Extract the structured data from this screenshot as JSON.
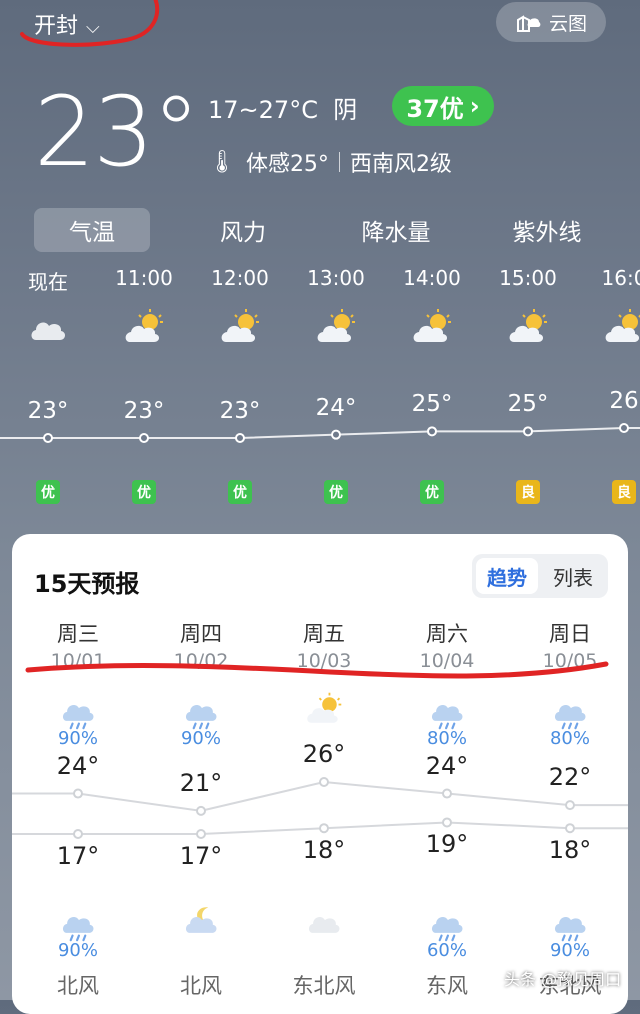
{
  "header": {
    "city": "开封",
    "cloud_map_label": "云图"
  },
  "current": {
    "temp": "23°",
    "range": "17~27°C",
    "condition": "阴",
    "aqi": "37优",
    "feels_like": "体感25°",
    "wind": "西南风2级"
  },
  "tabs": [
    "气温",
    "风力",
    "降水量",
    "紫外线"
  ],
  "hourly": [
    {
      "time": "现在",
      "icon": "cloud-icon",
      "temp": "23°",
      "aqi": "优",
      "aqi_color": "#3ec24f"
    },
    {
      "time": "11:00",
      "icon": "sun-cloud-icon",
      "temp": "23°",
      "aqi": "优",
      "aqi_color": "#3ec24f"
    },
    {
      "time": "12:00",
      "icon": "sun-cloud-icon",
      "temp": "23°",
      "aqi": "优",
      "aqi_color": "#3ec24f"
    },
    {
      "time": "13:00",
      "icon": "sun-cloud-icon",
      "temp": "24°",
      "aqi": "优",
      "aqi_color": "#3ec24f"
    },
    {
      "time": "14:00",
      "icon": "sun-cloud-icon",
      "temp": "25°",
      "aqi": "优",
      "aqi_color": "#3ec24f"
    },
    {
      "time": "15:00",
      "icon": "sun-cloud-icon",
      "temp": "25°",
      "aqi": "良",
      "aqi_color": "#e9b61a"
    },
    {
      "time": "16:0",
      "icon": "sun-cloud-icon",
      "temp": "26",
      "aqi": "良",
      "aqi_color": "#e9b61a"
    }
  ],
  "forecast": {
    "title": "15天预报",
    "view_trend": "趋势",
    "view_list": "列表",
    "days": [
      {
        "weekday": "周三",
        "date": "10/01",
        "day_icon": "rain-icon",
        "day_pct": "90%",
        "high": "24°",
        "low": "17°",
        "night_icon": "rain-icon",
        "night_pct": "90%",
        "wind": "北风"
      },
      {
        "weekday": "周四",
        "date": "10/02",
        "day_icon": "rain-icon",
        "day_pct": "90%",
        "high": "21°",
        "low": "17°",
        "night_icon": "moon-cloud-icon",
        "night_pct": "",
        "wind": "北风"
      },
      {
        "weekday": "周五",
        "date": "10/03",
        "day_icon": "sun-cloud-icon",
        "day_pct": "",
        "high": "26°",
        "low": "18°",
        "night_icon": "cloud-icon",
        "night_pct": "",
        "wind": "东北风"
      },
      {
        "weekday": "周六",
        "date": "10/04",
        "day_icon": "rain-icon",
        "day_pct": "80%",
        "high": "24°",
        "low": "19°",
        "night_icon": "rain-icon",
        "night_pct": "60%",
        "wind": "东风"
      },
      {
        "weekday": "周日",
        "date": "10/05",
        "day_icon": "rain-icon",
        "day_pct": "80%",
        "high": "22°",
        "low": "18°",
        "night_icon": "rain-icon",
        "night_pct": "90%",
        "wind": "东北风"
      }
    ]
  },
  "watermark": "头条 @豫见周口",
  "colors": {
    "aqi_good": "#3ec24f",
    "aqi_moderate": "#e9b61a",
    "accent": "#2f6fde",
    "annotation": "#e02424"
  }
}
